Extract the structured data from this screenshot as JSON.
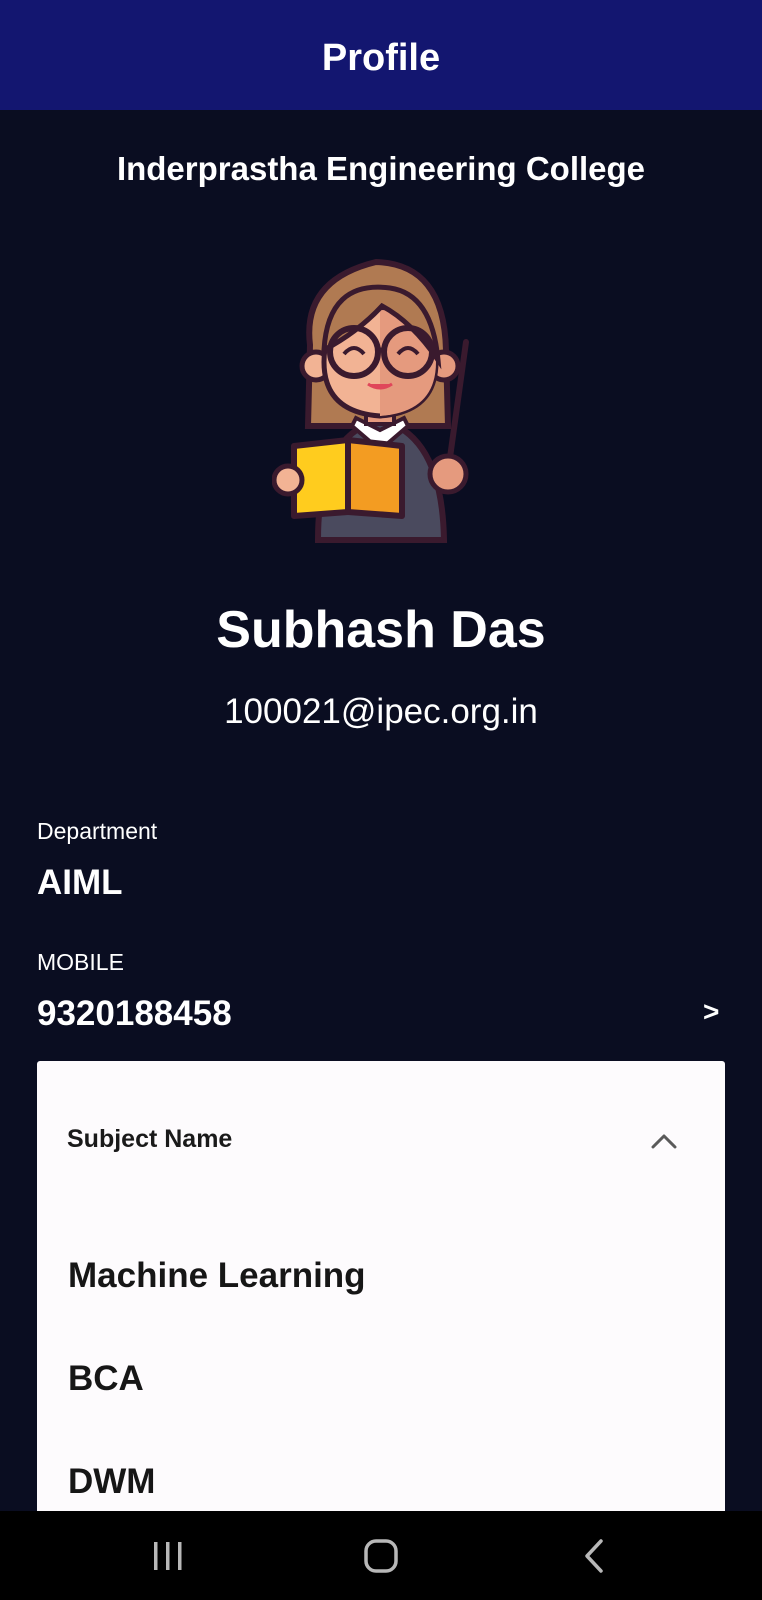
{
  "appbar": {
    "title": "Profile"
  },
  "college": {
    "name": "Inderprastha Engineering College"
  },
  "profile": {
    "avatar_icon": "teacher-avatar-icon",
    "name": "Subhash Das",
    "email": "100021@ipec.org.in"
  },
  "department": {
    "label": "Department",
    "value": "AIML"
  },
  "mobile": {
    "label": "MOBILE",
    "value": "9320188458",
    "action_label": ">"
  },
  "subjects": {
    "header": "Subject Name",
    "expanded": true,
    "items": [
      "Machine Learning",
      "BCA",
      "DWM"
    ]
  },
  "nav": {
    "recents_icon": "recents-icon",
    "home_icon": "home-icon",
    "back_icon": "back-icon"
  },
  "colors": {
    "appbar": "#131670",
    "background": "#0a0d21",
    "card": "#fdfbfd",
    "navbar": "#000000"
  }
}
